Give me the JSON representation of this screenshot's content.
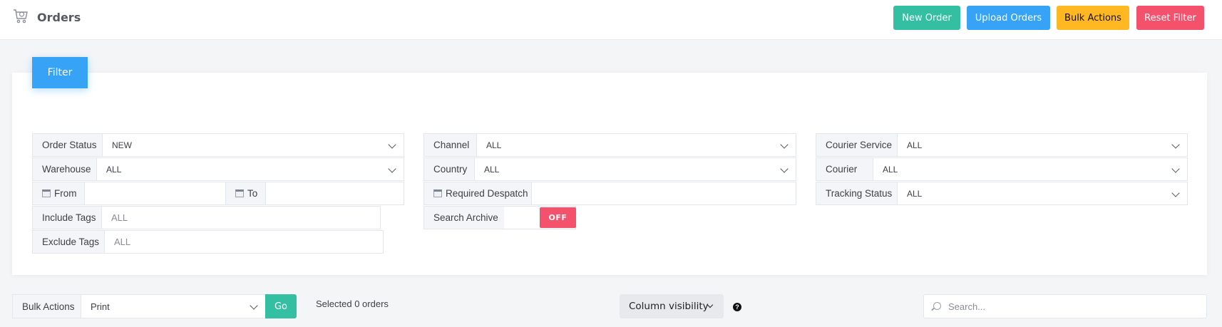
{
  "header": {
    "title": "Orders",
    "logo_icon": "cart-icon",
    "buttons": {
      "new_order": "New Order",
      "upload_orders": "Upload Orders",
      "bulk_actions": "Bulk Actions",
      "reset_filter": "Reset Filter"
    }
  },
  "filter": {
    "tab_label": "Filter",
    "order_status": {
      "label": "Order Status",
      "value": "NEW"
    },
    "warehouse": {
      "label": "Warehouse",
      "value": "ALL"
    },
    "from": {
      "label": "From",
      "value": ""
    },
    "to": {
      "label": "To",
      "value": ""
    },
    "include_tags": {
      "label": "Include Tags",
      "placeholder": "ALL"
    },
    "exclude_tags": {
      "label": "Exclude Tags",
      "placeholder": "ALL"
    },
    "channel": {
      "label": "Channel",
      "value": "ALL"
    },
    "country": {
      "label": "Country",
      "value": "ALL"
    },
    "required_despatch": {
      "label": "Required Despatch",
      "value": ""
    },
    "search_archive": {
      "label": "Search Archive",
      "toggle": "OFF"
    },
    "courier_service": {
      "label": "Courier Service",
      "value": "ALL"
    },
    "courier": {
      "label": "Courier",
      "value": "ALL"
    },
    "tracking_status": {
      "label": "Tracking Status",
      "value": "ALL"
    }
  },
  "bulk": {
    "label": "Bulk Actions",
    "selected": "Print",
    "go": "Go",
    "selected_count_text": "Selected 0 orders"
  },
  "table_tools": {
    "column_visibility": "Column visibility",
    "help": "?",
    "search_placeholder": "Search..."
  },
  "colors": {
    "green": "#34bfa3",
    "blue": "#36a3f7",
    "yellow": "#ffb822",
    "red": "#f4516c"
  }
}
